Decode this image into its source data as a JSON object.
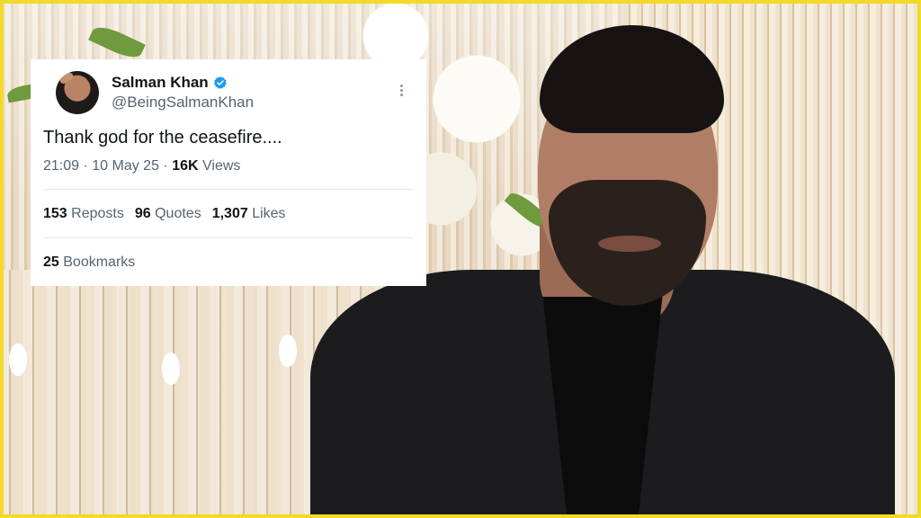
{
  "tweet": {
    "author_name": "Salman Khan",
    "author_handle": "@BeingSalmanKhan",
    "verified_color": "#1d9bf0",
    "text": "Thank god for the ceasefire....",
    "time": "21:09",
    "date": "10 May 25",
    "views_count": "16K",
    "views_label": "Views",
    "separator": " · ",
    "reposts_count": "153",
    "reposts_label": "Reposts",
    "quotes_count": "96",
    "quotes_label": "Quotes",
    "likes_count": "1,307",
    "likes_label": "Likes",
    "bookmarks_count": "25",
    "bookmarks_label": "Bookmarks",
    "more_icon": "more-vertical-icon"
  },
  "frame_color": "#f3d92a"
}
